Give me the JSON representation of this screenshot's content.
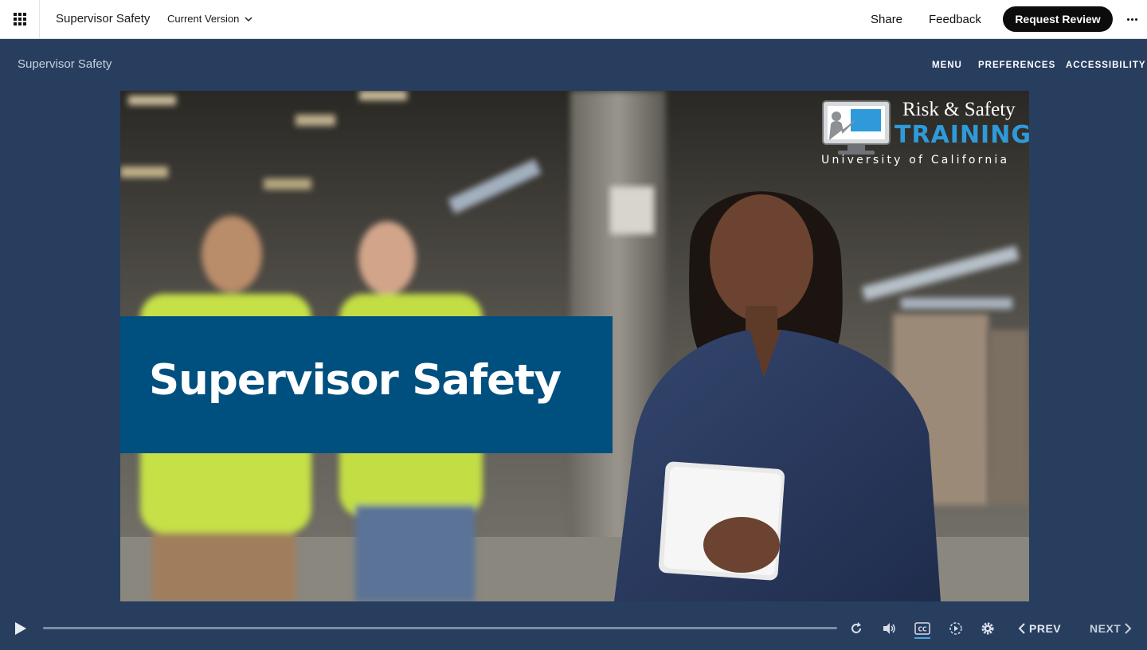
{
  "appbar": {
    "title": "Supervisor Safety",
    "version_label": "Current Version",
    "share_label": "Share",
    "feedback_label": "Feedback",
    "request_review_label": "Request Review"
  },
  "course": {
    "title": "Supervisor Safety",
    "nav": {
      "menu": "MENU",
      "preferences": "PREFERENCES",
      "accessibility": "ACCESSIBILITY"
    }
  },
  "slide": {
    "heading": "Supervisor Safety",
    "logo": {
      "line1": "Risk & Safety",
      "line2": "TRAINING",
      "line3": "University of California"
    }
  },
  "player": {
    "prev_label": "PREV",
    "next_label": "NEXT",
    "progress": 0,
    "icons": [
      "play-icon",
      "replay-icon",
      "volume-icon",
      "closed-captions-icon",
      "playback-speed-icon",
      "settings-gear-icon",
      "chevron-left-icon",
      "chevron-right-icon"
    ]
  },
  "colors": {
    "page_bg": "#273e5f",
    "banner_bg": "#00507f",
    "logo_accent": "#2f9ad9",
    "button_bg": "#0c0c0c"
  }
}
